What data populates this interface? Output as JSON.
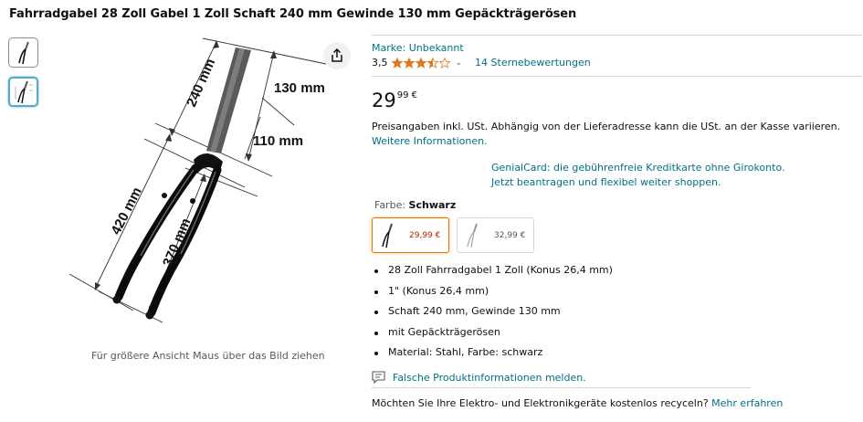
{
  "title": "Fahrradgabel 28 Zoll Gabel 1 Zoll Schaft 240 mm Gewinde 130 mm Gepäckträgerösen",
  "image": {
    "dimensions": {
      "d240": "240 mm",
      "d130": "130 mm",
      "d110": "110 mm",
      "d420": "420 mm",
      "d370": "370 mm"
    },
    "hover_hint": "Für größere Ansicht Maus über das Bild ziehen"
  },
  "brand": "Marke: Unbekannt",
  "rating": {
    "value": "3,5",
    "stars": 3.5,
    "reviews": "14 Sternebewertungen"
  },
  "price": {
    "whole": "29",
    "fraction": "99 €"
  },
  "tax": {
    "text": "Preisangaben inkl. USt. Abhängig von der Lieferadresse kann die USt. an der Kasse variieren. ",
    "link": "Weitere Informationen."
  },
  "genial": {
    "line1": "GenialCard: die gebührenfreie Kreditkarte ohne Girokonto.",
    "line2": "Jetzt beantragen und flexibel weiter shoppen."
  },
  "color": {
    "label": "Farbe: ",
    "value": "Schwarz"
  },
  "swatches": [
    {
      "price": "29,99 €"
    },
    {
      "price": "32,99 €"
    }
  ],
  "bullets": [
    "28 Zoll Fahrradgabel 1 Zoll (Konus 26,4 mm)",
    "1\" (Konus 26,4 mm)",
    "Schaft 240 mm, Gewinde 130 mm",
    "mit Gepäckträgerösen",
    "Material: Stahl, Farbe: schwarz"
  ],
  "report": "Falsche Produktinformationen melden.",
  "recycle": {
    "text": "Möchten Sie Ihre Elektro- und Elektronikgeräte kostenlos recyceln? ",
    "link": "Mehr erfahren"
  },
  "colors": {
    "link": "#007185",
    "star": "#de7921",
    "price_red": "#b12704",
    "selected_border": "#e77600"
  }
}
